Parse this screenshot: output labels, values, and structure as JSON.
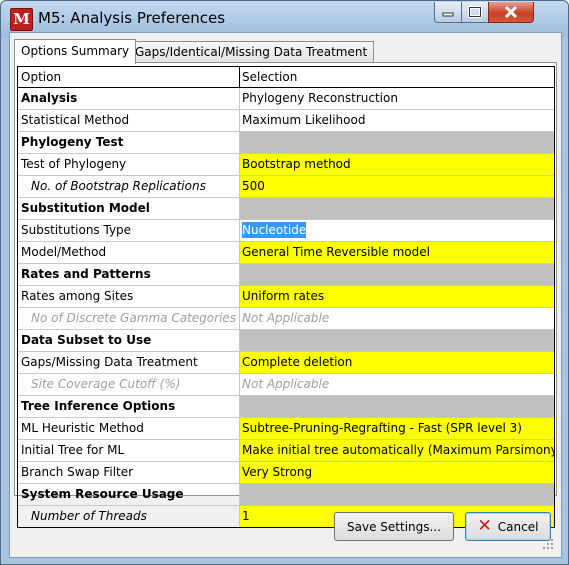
{
  "window": {
    "title": "M5: Analysis Preferences",
    "app_icon_letter": "M"
  },
  "tabs": [
    {
      "label": "Options Summary",
      "active": true
    },
    {
      "label": "Gaps/Identical/Missing Data Treatment",
      "active": false
    }
  ],
  "grid": {
    "headers": {
      "option": "Option",
      "selection": "Selection"
    },
    "rows": [
      {
        "option": "Analysis",
        "selection": "Phylogeny Reconstruction"
      },
      {
        "option": "Statistical Method",
        "selection": "Maximum Likelihood"
      },
      {
        "option": "Phylogeny Test",
        "selection": ""
      },
      {
        "option": "Test of Phylogeny",
        "selection": "Bootstrap method"
      },
      {
        "option": "No. of Bootstrap Replications",
        "selection": "500"
      },
      {
        "option": "Substitution Model",
        "selection": ""
      },
      {
        "option": "Substitutions Type",
        "selection": "Nucleotide"
      },
      {
        "option": "Model/Method",
        "selection": "General Time Reversible model"
      },
      {
        "option": "Rates and Patterns",
        "selection": ""
      },
      {
        "option": "Rates among Sites",
        "selection": "Uniform rates"
      },
      {
        "option": "No of Discrete Gamma Categories",
        "selection": "Not Applicable"
      },
      {
        "option": "Data Subset to Use",
        "selection": ""
      },
      {
        "option": "Gaps/Missing Data Treatment",
        "selection": "Complete deletion"
      },
      {
        "option": "Site Coverage Cutoff (%)",
        "selection": "Not Applicable"
      },
      {
        "option": "Tree Inference Options",
        "selection": ""
      },
      {
        "option": "ML Heuristic Method",
        "selection": "Subtree-Pruning-Regrafting - Fast (SPR level 3)"
      },
      {
        "option": "Initial Tree for ML",
        "selection": "Make initial tree automatically (Maximum Parsimony)"
      },
      {
        "option": "Branch Swap Filter",
        "selection": "Very Strong"
      },
      {
        "option": "System Resource Usage",
        "selection": ""
      },
      {
        "option": "Number of Threads",
        "selection": "1"
      }
    ]
  },
  "buttons": {
    "save": "Save Settings...",
    "cancel": "Cancel"
  },
  "colors": {
    "editable_cell": "#ffff00",
    "section_cell": "#c0c0c0",
    "selection_highlight": "#3399ff"
  }
}
